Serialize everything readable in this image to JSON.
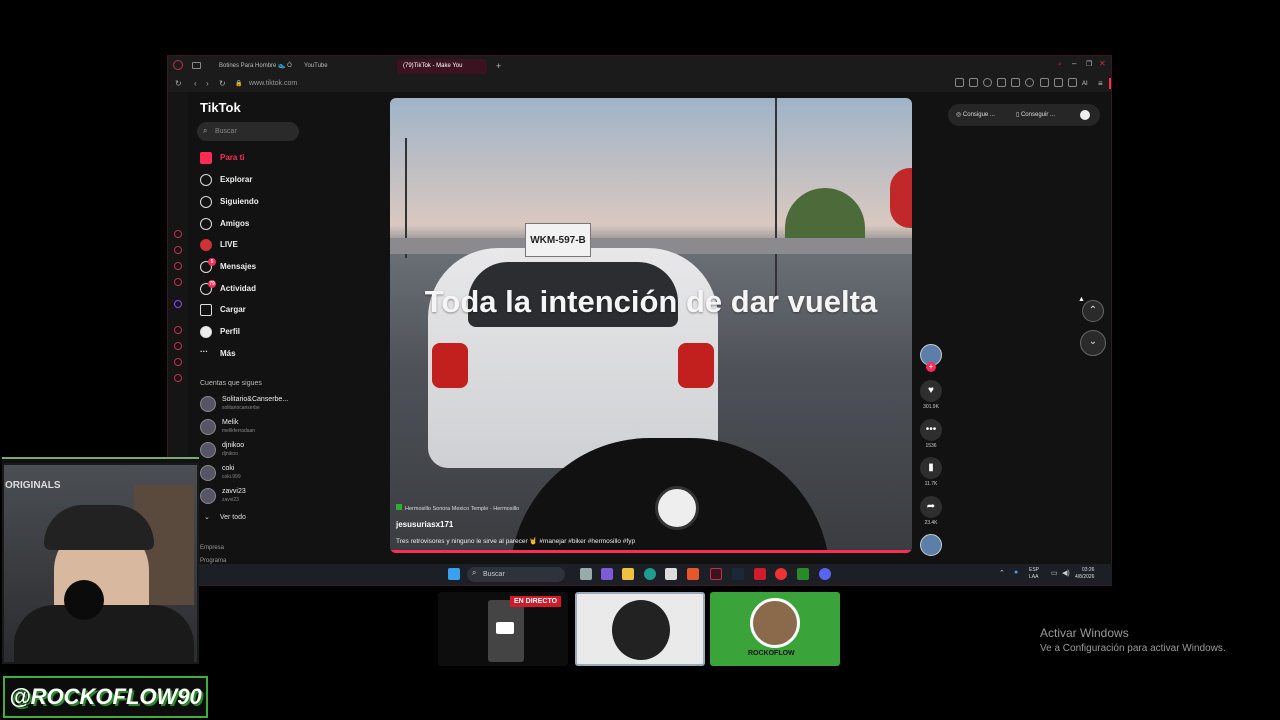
{
  "browser": {
    "tabs": [
      {
        "label": "Botines Para Hombre 👟 Ó"
      },
      {
        "label": "YouTube"
      },
      {
        "label": "(79)TikTok - Make You"
      }
    ],
    "new_tab": "+",
    "url": "www.tiktok.com",
    "ai_label": "AI"
  },
  "tiktok": {
    "logo": "TikTok",
    "search_placeholder": "Buscar",
    "nav": [
      {
        "label": "Para ti",
        "icon": "home-icon"
      },
      {
        "label": "Explorar",
        "icon": "compass-icon"
      },
      {
        "label": "Siguiendo",
        "icon": "following-icon"
      },
      {
        "label": "Amigos",
        "icon": "friends-icon"
      },
      {
        "label": "LIVE",
        "icon": "live-icon"
      },
      {
        "label": "Mensajes",
        "icon": "messages-icon",
        "badge": "5"
      },
      {
        "label": "Actividad",
        "icon": "activity-icon",
        "badge": "79"
      },
      {
        "label": "Cargar",
        "icon": "upload-icon"
      },
      {
        "label": "Perfil",
        "icon": "profile-icon"
      },
      {
        "label": "Más",
        "icon": "more-icon"
      }
    ],
    "following_title": "Cuentas que sigues",
    "following": [
      {
        "name": "Solitario&Canserbe...",
        "handle": "solitariocanserbe"
      },
      {
        "name": "Melik",
        "handle": "melikferradaan"
      },
      {
        "name": "djnikoo",
        "handle": "djnikoo"
      },
      {
        "name": "coki",
        "handle": "coki.999"
      },
      {
        "name": "zavvi23",
        "handle": "zavvi23"
      }
    ],
    "see_all": "Ver todo",
    "footer": [
      "Empresa",
      "Programa"
    ],
    "video": {
      "overlay_text": "Toda la intención de dar vuelta",
      "plate": "WKM-597-B",
      "location": "Hermosillo Sonora Mexico Temple · Hermosillo",
      "author": "jesusuriasx171",
      "description": "Tres retrovisores y ninguno le sirve al parecer 🤘 #manejar #biker #hermosillo #fyp",
      "likes": "301.9K",
      "comments": "1536",
      "saves": "11.7K",
      "shares": "23.4K"
    },
    "extension_bar": {
      "item1": "Consigue ...",
      "item2": "Conseguir ..."
    }
  },
  "taskbar": {
    "search": "Buscar",
    "lang1": "ESP",
    "lang2": "LAA",
    "time": "03:26",
    "date": "4/8/2026"
  },
  "overlay": {
    "webcam_label": "ORIGINALS",
    "handle": "@ROCKOFLOW90",
    "live_badge": "EN DIRECTO",
    "logo_text": "ROCKOFLOW"
  },
  "activate_windows": {
    "title": "Activar Windows",
    "subtitle": "Ve a Configuración para activar Windows."
  },
  "colors": {
    "accent": "#fe2c55",
    "green": "#3fae3f"
  }
}
